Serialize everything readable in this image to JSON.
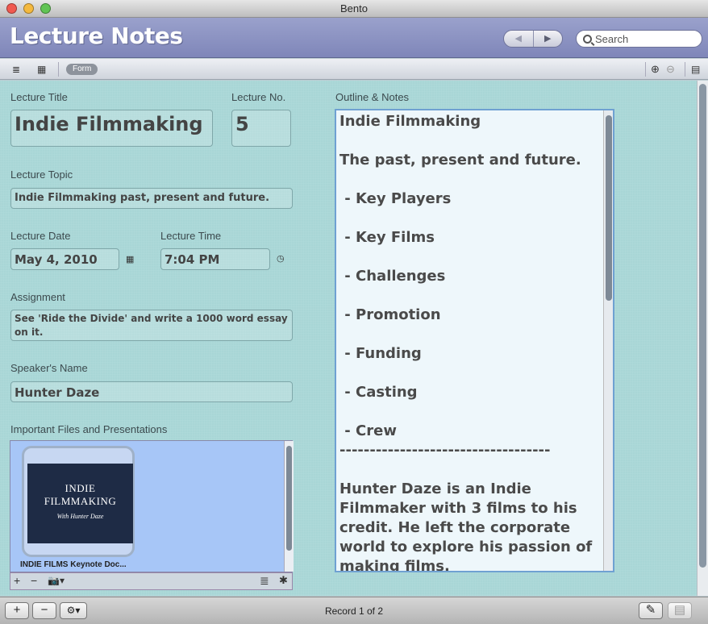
{
  "window": {
    "title": "Bento"
  },
  "header": {
    "app_title": "Lecture Notes",
    "nav_back": "◀",
    "nav_forward": "▶",
    "search_placeholder": "Search"
  },
  "toolbar": {
    "form_label": "Form",
    "list_view_icon": "≣",
    "grid_view_icon": "▦",
    "add_field_icon": "⊕",
    "remove_field_icon": "⊖",
    "inspector_icon": "▤"
  },
  "form": {
    "lecture_title": {
      "label": "Lecture Title",
      "value": "Indie Filmmaking"
    },
    "lecture_no": {
      "label": "Lecture No.",
      "value": "5"
    },
    "lecture_topic": {
      "label": "Lecture Topic",
      "value": "Indie Filmmaking past, present and future."
    },
    "lecture_date": {
      "label": "Lecture Date",
      "value": "May 4, 2010"
    },
    "lecture_time": {
      "label": "Lecture Time",
      "value": "7:04 PM"
    },
    "assignment": {
      "label": "Assignment",
      "value": "See 'Ride the Divide' and write a 1000 word essay on it."
    },
    "speaker": {
      "label": "Speaker's Name",
      "value": "Hunter Daze"
    },
    "files": {
      "label": "Important Files and Presentations",
      "slide_title": "INDIE FILMMAKING",
      "slide_subtitle": "With Hunter Daze",
      "file_name": "INDIE FILMS Keynote Doc...",
      "add": "+",
      "remove": "−",
      "camera": "📷▾",
      "list": "≣",
      "gear": "✱"
    },
    "notes": {
      "label": "Outline & Notes",
      "text": "Indie Filmmaking\n\nThe past, present and future.\n\n - Key Players\n\n - Key Films\n\n - Challenges\n\n - Promotion\n\n - Funding\n\n - Casting\n\n - Crew\n-----------------------------------\n\nHunter Daze is an Indie Filmmaker with 3 films to his credit. He left the corporate world to explore his passion of making films."
    }
  },
  "bottom": {
    "add": "+",
    "remove": "−",
    "gear": "⚙▾",
    "record": "Record 1 of 2",
    "edit_icon": "✎",
    "view_icon": "▤"
  },
  "colors": {
    "header": "#8f96c4",
    "content": "#a8d6d6",
    "accent": "#6fa1d2"
  }
}
